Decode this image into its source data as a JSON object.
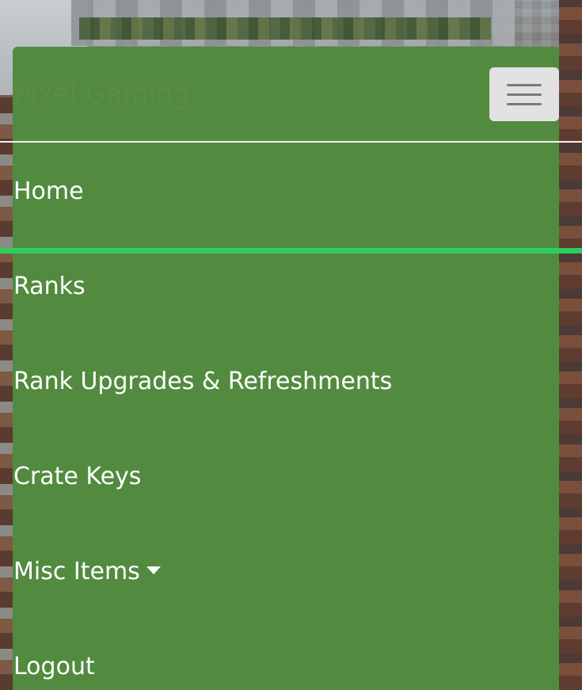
{
  "brand": {
    "name": "Pixel Gaming"
  },
  "toggler": {
    "icon": "hamburger-menu-icon"
  },
  "nav": {
    "items": [
      {
        "label": "Home"
      },
      {
        "label": "Ranks"
      },
      {
        "label": "Rank Upgrades & Refreshments"
      },
      {
        "label": "Crate Keys"
      },
      {
        "label": "Misc Items",
        "icon": "caret-down-icon"
      },
      {
        "label": "Logout"
      }
    ]
  },
  "colors": {
    "navbar_bg": "#528b3f",
    "brand_text": "#5d8a4b",
    "active_indicator": "#2ecc5f",
    "toggler_bg": "#e2e2e2",
    "link_text": "#ffffff"
  }
}
